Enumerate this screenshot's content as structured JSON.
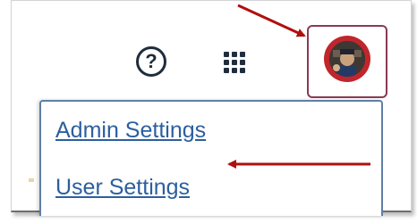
{
  "toolbar": {
    "help_label": "?",
    "help_icon": "help-circle-icon",
    "apps_icon": "app-grid-icon",
    "avatar_icon": "user-avatar-icon"
  },
  "menu": {
    "items": [
      {
        "label": "Admin Settings"
      },
      {
        "label": "User Settings"
      }
    ]
  },
  "colors": {
    "link": "#2c5f9e",
    "menu_border": "#5f7fa6",
    "avatar_border": "#8b3a52",
    "avatar_ring": "#c0262b",
    "arrow": "#b00f0f",
    "icon": "#1f2d3d"
  }
}
